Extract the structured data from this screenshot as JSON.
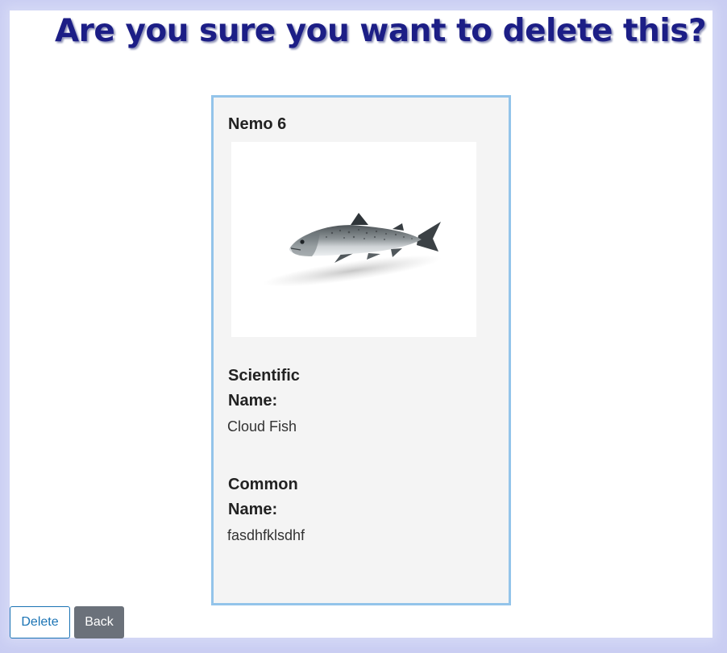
{
  "page": {
    "heading": "Are you sure you want to delete this?"
  },
  "card": {
    "title": "Nemo 6",
    "image_subject": "salmon",
    "scientific_name_label": "Scientific Name:",
    "scientific_name_value": "Cloud Fish",
    "common_name_label": "Common Name:",
    "common_name_value": "fasdhfklsdhf"
  },
  "actions": {
    "delete_label": "Delete",
    "back_label": "Back"
  },
  "colors": {
    "heading": "#1c1e86",
    "card_border": "#93c4ea",
    "delete_outline": "#1a73b4",
    "back_fill": "#6b717a"
  }
}
